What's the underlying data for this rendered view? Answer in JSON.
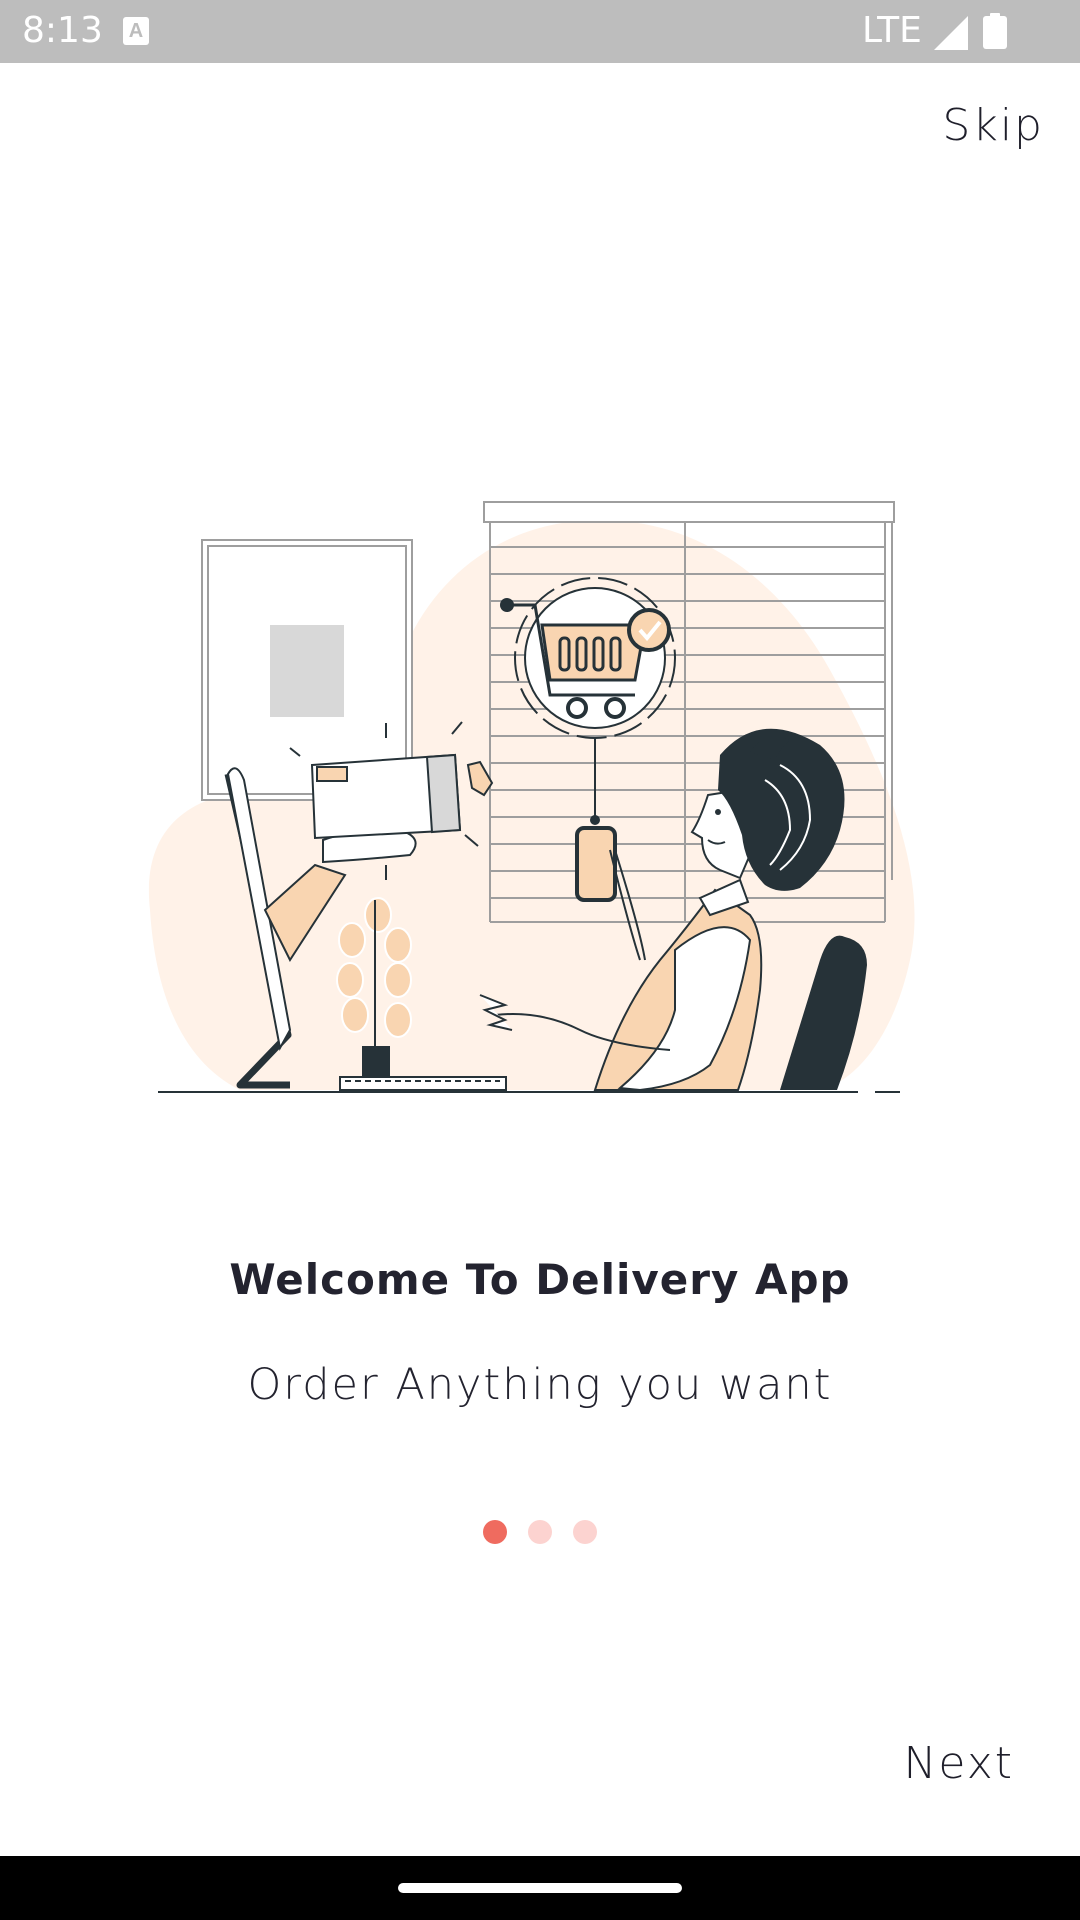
{
  "status_bar": {
    "time": "8:13",
    "notification_icon": "text-a-icon",
    "notification_glyph": "A",
    "network": "LTE",
    "signal_icon": "signal-icon",
    "battery_icon": "battery-icon"
  },
  "header": {
    "skip_label": "Skip"
  },
  "illustration": {
    "icon": "online-shopping-illustration"
  },
  "content": {
    "title": "Welcome To Delivery App",
    "subtitle": "Order Anything you want"
  },
  "pager": {
    "pages": 3,
    "active_index": 0,
    "active_color": "#ef6b5f",
    "inactive_color": "#fcd3d0"
  },
  "footer": {
    "next_label": "Next"
  },
  "colors": {
    "accent_peach": "#f9d5b1",
    "blob": "#fff2e8",
    "dark": "#263238",
    "text": "#23232f"
  }
}
